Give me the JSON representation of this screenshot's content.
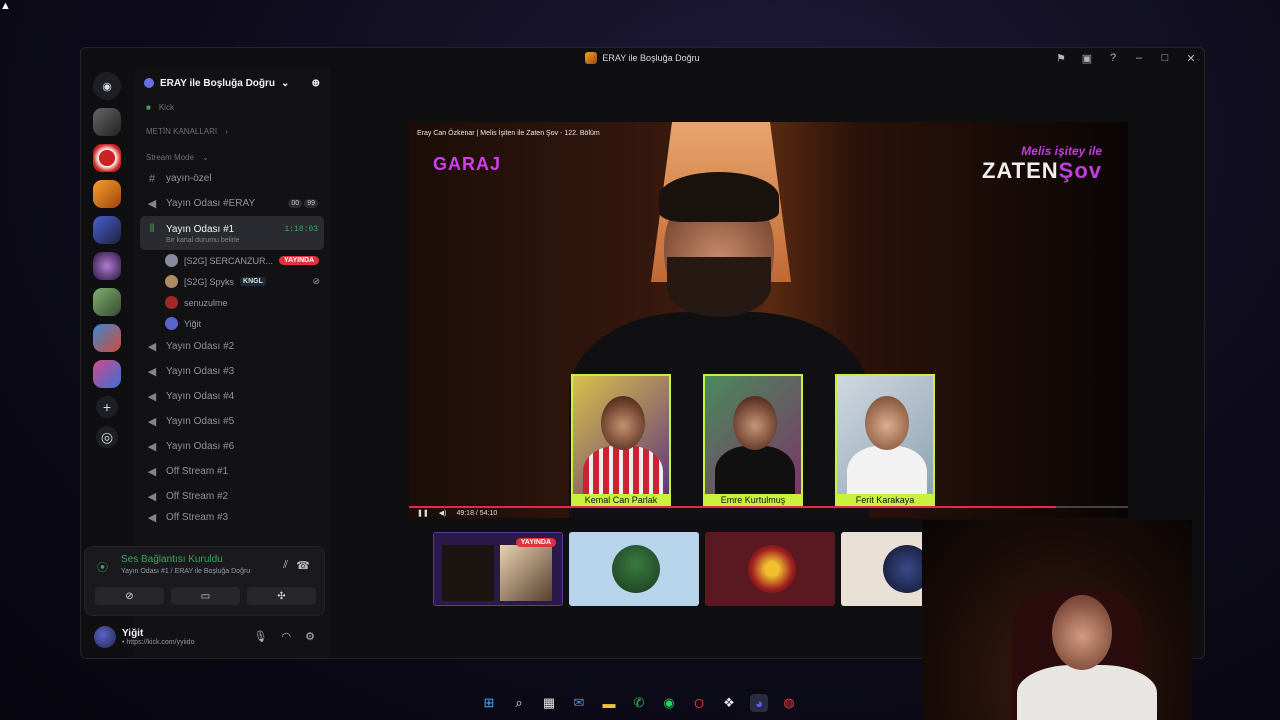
{
  "window": {
    "title": "ERAY ile Boşluğa Doğru"
  },
  "sidebar": {
    "server_name": "ERAY ile Boşluğa Doğru",
    "kick_label": "Kick",
    "category_text": "METİN KANALLARI",
    "category_stream": "Stream Mode",
    "channels": {
      "c1": "yayın-özel",
      "c2": "Yayın Odası #ERAY",
      "c2_count_a": "00",
      "c2_count_b": "99",
      "active": "Yayın Odası #1",
      "active_time": "1:18:03",
      "active_status": "Bir kanal durumu belirle",
      "c4": "Yayın Odası #2",
      "c5": "Yayın Odası #3",
      "c6": "Yayın Odası #4",
      "c7": "Yayın Odası #5",
      "c8": "Yayın Odası #6",
      "c9": "Off Stream #1",
      "c10": "Off Stream #2",
      "c11": "Off Stream #3"
    },
    "voice_users": [
      {
        "name": "[S2G] SERCANZUR...",
        "badge": "YAYINDA"
      },
      {
        "name": "[S2G] Spyks",
        "badge": "KNGL"
      },
      {
        "name": "senuzulme"
      },
      {
        "name": "Yiğit"
      }
    ]
  },
  "voice_panel": {
    "status": "Ses Bağlantısı Kuruldu",
    "sub": "Yayın Odası #1 / ERAY ile Boşluğa Doğru"
  },
  "user_panel": {
    "name": "Yiğit",
    "status": "• https://kick.com/yyiido"
  },
  "stage": {
    "caption": "Eray Can Özkenar | Melis İşiten ile Zaten Şov - 122. Bölüm",
    "logo_left": "GARAJ",
    "logo_right_top": "Melis işitey ile",
    "logo_right_main": "ZATEN",
    "logo_right_accent": "Şov",
    "guests": [
      "Kemal Can Parlak",
      "Emre Kurtulmuş",
      "Ferit Karakaya"
    ],
    "time": "49:18 / 54:10",
    "progress": 0.9
  },
  "thumbs": {
    "live_badge": "YAYINDA"
  },
  "icons": {
    "discord": "discord-icon",
    "add_server": "plus-icon",
    "discover": "compass-icon"
  },
  "colors": {
    "accent_green": "#3ba55c",
    "live_red": "#e0323c",
    "garaj_purple": "#d03cf0",
    "guest_frame": "#c8f23c"
  }
}
